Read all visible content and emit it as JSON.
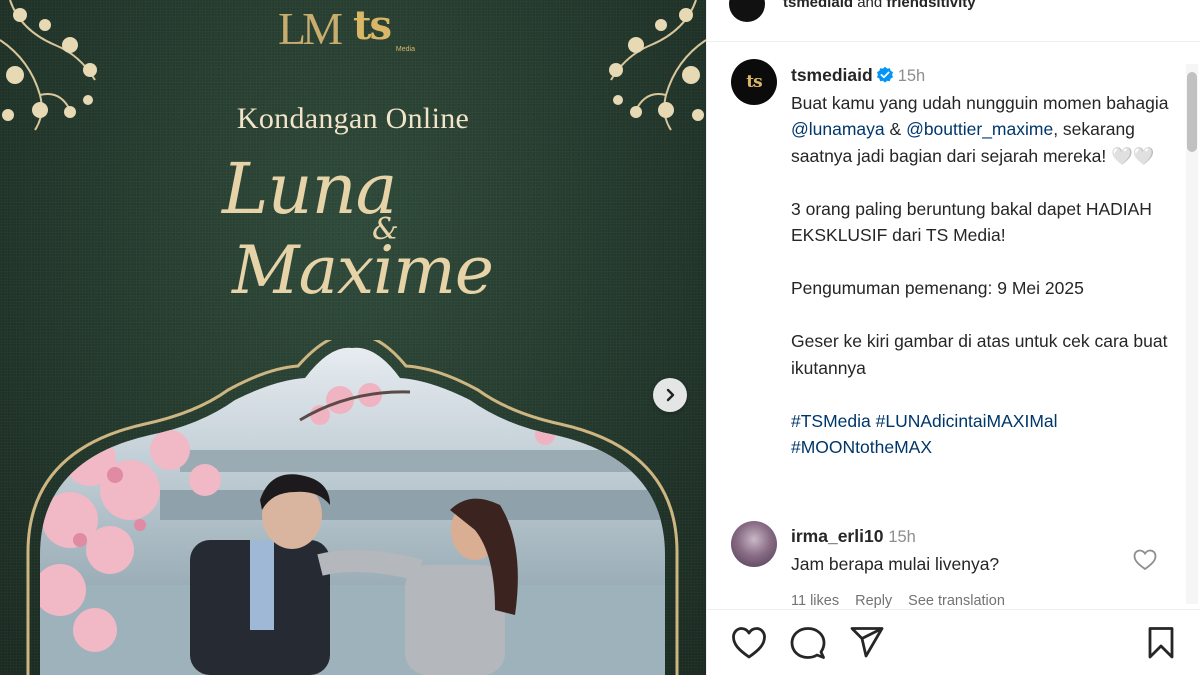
{
  "post_image": {
    "logo_left": "LM",
    "logo_right": "ts",
    "logo_right_sub": "Media",
    "headline": "Kondangan Online",
    "name_1": "Luna",
    "ampersand": "&",
    "name_2": "Maxime"
  },
  "header": {
    "account": "tsmediaid",
    "connector": " and ",
    "collaborator": "friendsitivity"
  },
  "caption": {
    "username": "tsmediaid",
    "time": "15h",
    "line_1": "Buat kamu yang udah nungguin momen bahagia ",
    "mention_1": "@lunamaya",
    "amp": " & ",
    "mention_2": "@bouttier_maxime",
    "line_1_end": ", sekarang saatnya jadi bagian dari sejarah mereka! 🤍🤍",
    "paragraph_2": "3 orang paling beruntung bakal dapet HADIAH EKSKLUSIF dari TS Media!",
    "paragraph_3": "Pengumuman pemenang: 9 Mei 2025",
    "paragraph_4": "Geser ke kiri gambar di atas untuk cek cara buat ikutannya",
    "hashtag_1": "#TSMedia",
    "hashtag_2": "#LUNAdicintaiMAXIMal",
    "hashtag_3": "#MOONtotheMAX",
    "avatar_text": "ts"
  },
  "comment": {
    "username": "irma_erli10",
    "time": "15h",
    "text": "Jam berapa mulai livenya?",
    "likes": "11 likes",
    "reply": "Reply",
    "translate": "See translation"
  },
  "icons": {
    "like": "heart-icon",
    "comment": "comment-icon",
    "share": "share-icon",
    "save": "bookmark-icon",
    "next": "chevron-right-icon",
    "verified": "verified-badge-icon"
  },
  "colors": {
    "link": "#00376b",
    "verified": "#0095f6",
    "meta": "#8e8e8e",
    "image_green": "#24392d",
    "gold": "#d9b766"
  }
}
